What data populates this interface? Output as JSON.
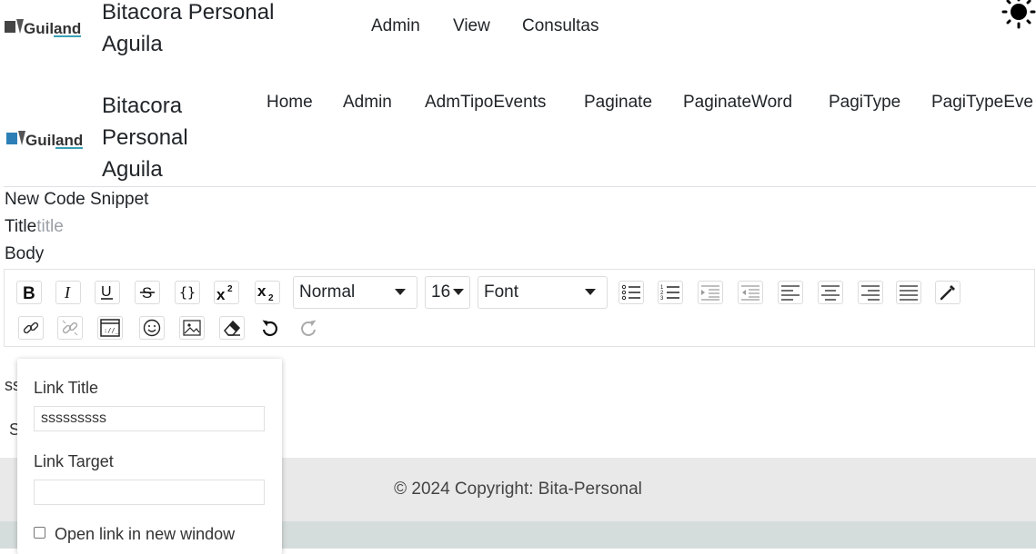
{
  "header1": {
    "brand": "Bitacora Personal Aguila",
    "nav": [
      "Admin",
      "View",
      "Consultas"
    ]
  },
  "header2": {
    "brand": "Bitacora Personal Aguila",
    "nav": [
      "Home",
      "Admin",
      "AdmTipoEvents",
      "Paginate",
      "PaginateWord",
      "PagiType",
      "PagiTypeEve"
    ]
  },
  "logo_text": "Guiland",
  "form": {
    "heading": "New Code Snippet",
    "title_label": "Title",
    "title_placeholder": "title",
    "body_label": "Body"
  },
  "editor": {
    "style_select": "Normal",
    "size_select": "16",
    "font_select": "Font",
    "body_text_fragment": "ss",
    "submit_fragment": "S"
  },
  "link_popup": {
    "title_label": "Link Title",
    "title_value": "sssssssss",
    "target_label": "Link Target",
    "target_value": "",
    "new_window_label": "Open link in new window"
  },
  "footer": {
    "text": "© 2024 Copyright: Bita-Personal"
  },
  "icons": [
    "sun-icon",
    "bold-icon",
    "italic-icon",
    "underline-icon",
    "strikethrough-icon",
    "code-icon",
    "superscript-icon",
    "subscript-icon",
    "unordered-list-icon",
    "ordered-list-icon",
    "indent-icon",
    "outdent-icon",
    "align-left-icon",
    "align-center-icon",
    "align-right-icon",
    "justify-icon",
    "color-picker-icon",
    "link-icon",
    "unlink-icon",
    "embed-icon",
    "emoji-icon",
    "image-icon",
    "eraser-icon",
    "undo-icon",
    "redo-icon"
  ]
}
